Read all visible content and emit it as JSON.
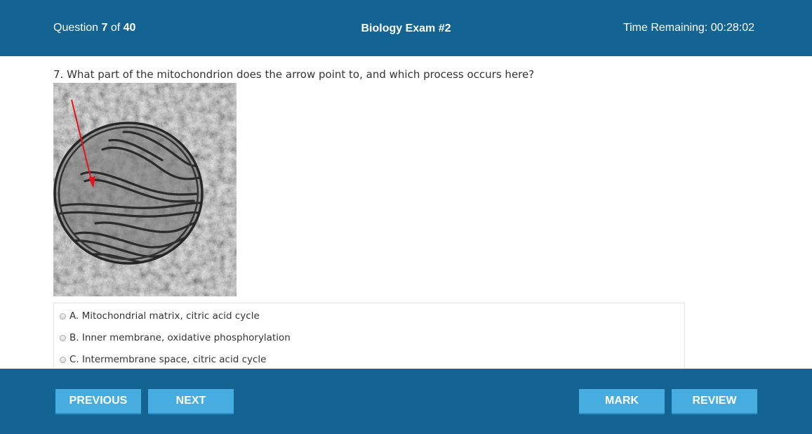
{
  "header": {
    "question_prefix": "Question ",
    "question_current": "7",
    "question_of": " of ",
    "question_total": "40",
    "title": "Biology Exam #2",
    "time_label": "Time Remaining: ",
    "time_value": "00:28:02"
  },
  "question": {
    "text": "7. What part of the mitochondrion does the arrow point to, and which process occurs here?"
  },
  "answers": [
    {
      "label": "A. Mitochondrial matrix, citric acid cycle"
    },
    {
      "label": "B. Inner membrane, oxidative phosphorylation"
    },
    {
      "label": "C. Intermembrane space, citric acid cycle"
    }
  ],
  "footer": {
    "previous": "PREVIOUS",
    "next": "NEXT",
    "mark": "MARK",
    "review": "REVIEW"
  },
  "colors": {
    "bar": "#136393",
    "button": "#47ade0",
    "arrow": "#e3141b"
  }
}
